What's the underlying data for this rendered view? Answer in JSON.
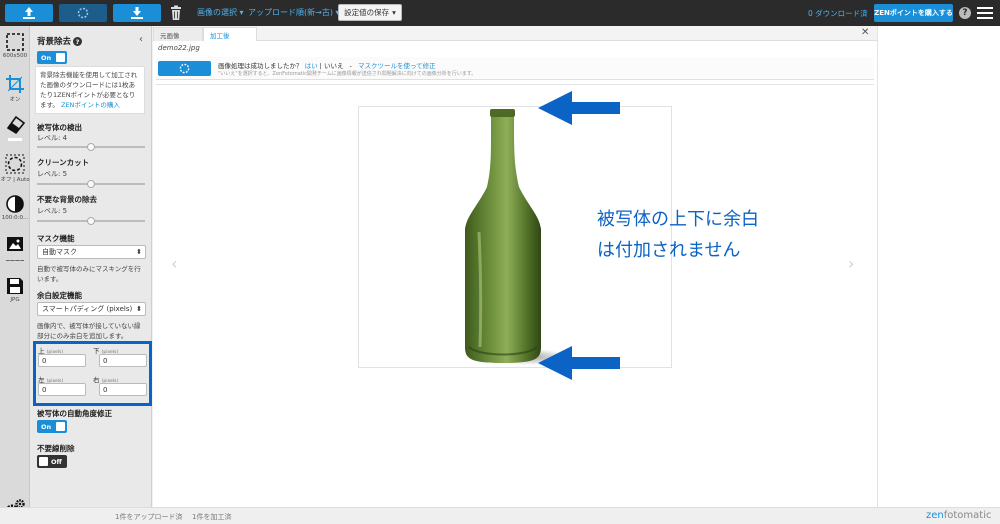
{
  "topbar": {
    "select_images": "画像の選択",
    "upload_menu": "アップロード順(新→古)",
    "save_settings": "設定値の保存",
    "download_counter": "0 ダウンロード済",
    "buy_points": "ZENポイントを購入する",
    "help": "?"
  },
  "rail": {
    "canvas_size": "600x500",
    "crop_label": "オン",
    "rotate_label": "オフ | Auto",
    "contrast_label": "100:0:0...",
    "format_label": "JPG"
  },
  "panel": {
    "bg_removal_title": "背景除去",
    "bg_toggle": "On",
    "info_text": "背景除去機能を使用して加工された画像のダウンロードには1枚あたり1ZENポイントが必要となります。",
    "info_link": "ZENポイントの購入",
    "detect_title": "被写体の検出",
    "detect_level": "レベル: 4",
    "detect_value": 0.5,
    "cleancut_title": "クリーンカット",
    "cleancut_level": "レベル: 5",
    "cleancut_value": 0.5,
    "unwanted_title": "不要な背景の除去",
    "unwanted_level": "レベル: 5",
    "unwanted_value": 0.5,
    "mask_title": "マスク機能",
    "mask_select": "自動マスク",
    "mask_help": "自動で被写体のみにマスキングを行います。",
    "padding_title": "余白設定機能",
    "padding_select": "スマートパディング (pixels)",
    "padding_help": "画像内で、被写体が接していない縁部分にのみ余白を追加します。",
    "pad_top_label": "上",
    "pad_bottom_label": "下",
    "pad_left_label": "左",
    "pad_right_label": "右",
    "pixels_unit": "(pixels)",
    "pad_top": "0",
    "pad_bottom": "0",
    "pad_left": "0",
    "pad_right": "0",
    "auto_angle_title": "被写体の自動角度修正",
    "auto_angle_toggle": "On",
    "line_removal_title": "不要線削除",
    "line_removal_toggle": "Off"
  },
  "main": {
    "tab_original": "元画像",
    "tab_processed": "加工後",
    "filename": "demo22.jpg",
    "feedback_question": "画像処理は成功しましたか？",
    "feedback_yes": "はい",
    "feedback_sep1": "|",
    "feedback_no": "いいえ",
    "feedback_sep2": "-",
    "feedback_mask": "マスクツールを使って修正",
    "feedback_note": "\"いいえ\"を選択すると、ZenFotomatic開発チームに画像情報が送信され問題解決に向けての画像分析を行います。",
    "annotation_line1": "被写体の上下に余白",
    "annotation_line2": "は付加されません"
  },
  "status": {
    "uploaded": "1件をアップロード済",
    "processed": "1件を加工済",
    "brand_zen": "zen",
    "brand_rest": "fotomatic"
  },
  "colors": {
    "accent": "#1a8fd8",
    "annotation": "#0b63c5",
    "bottle": "#5a7d32"
  }
}
